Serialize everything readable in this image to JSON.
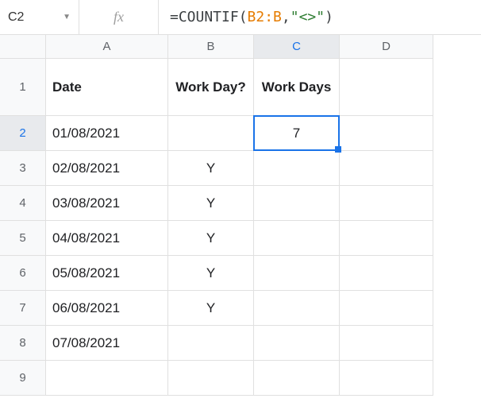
{
  "formulaBar": {
    "nameBox": "C2",
    "fxLabel": "fx",
    "formula": {
      "prefix": "=COUNTIF",
      "open": "(",
      "range": "B2:B",
      "comma": ",",
      "string": "\"<>\"",
      "close": ")"
    }
  },
  "columns": [
    "A",
    "B",
    "C",
    "D"
  ],
  "rowNumbers": [
    "1",
    "2",
    "3",
    "4",
    "5",
    "6",
    "7",
    "8",
    "9"
  ],
  "activeCell": {
    "row": 2,
    "col": "C"
  },
  "headers": {
    "A": "Date",
    "B": "Work Day?",
    "C": "Work Days"
  },
  "cells": [
    {
      "A": "01/08/2021",
      "B": "",
      "C": "7"
    },
    {
      "A": "02/08/2021",
      "B": "Y",
      "C": ""
    },
    {
      "A": "03/08/2021",
      "B": "Y",
      "C": ""
    },
    {
      "A": "04/08/2021",
      "B": "Y",
      "C": ""
    },
    {
      "A": "05/08/2021",
      "B": "Y",
      "C": ""
    },
    {
      "A": "06/08/2021",
      "B": "Y",
      "C": ""
    },
    {
      "A": "07/08/2021",
      "B": "",
      "C": ""
    },
    {
      "A": "",
      "B": "",
      "C": ""
    }
  ],
  "chart_data": {
    "type": "table",
    "columns": [
      "Date",
      "Work Day?",
      "Work Days"
    ],
    "rows": [
      [
        "01/08/2021",
        "",
        7
      ],
      [
        "02/08/2021",
        "Y",
        null
      ],
      [
        "03/08/2021",
        "Y",
        null
      ],
      [
        "04/08/2021",
        "Y",
        null
      ],
      [
        "05/08/2021",
        "Y",
        null
      ],
      [
        "06/08/2021",
        "Y",
        null
      ],
      [
        "07/08/2021",
        "",
        null
      ]
    ]
  }
}
